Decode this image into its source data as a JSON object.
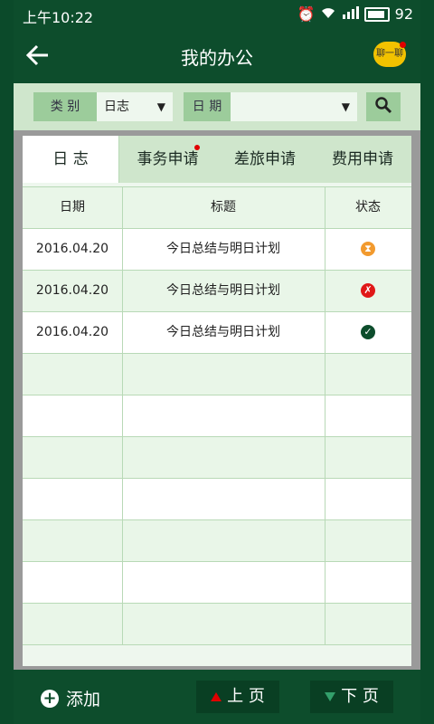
{
  "status_bar": {
    "time": "上午10:22",
    "battery": "92",
    "icons": [
      "alarm-icon",
      "wifi-icon",
      "signal-4g-icon",
      "battery-icon"
    ]
  },
  "header": {
    "back_icon": "back-arrow-icon",
    "title": "我的办公",
    "chat_label": "聊一聊"
  },
  "filters": {
    "category_label": "类 别",
    "category_value": "日志",
    "date_label": "日 期",
    "date_value": "",
    "search_icon": "search-icon"
  },
  "tabs": [
    {
      "label": "日   志",
      "active": true,
      "badge": false
    },
    {
      "label": "事务申请",
      "active": false,
      "badge": true
    },
    {
      "label": "差旅申请",
      "active": false,
      "badge": false
    },
    {
      "label": "费用申请",
      "active": false,
      "badge": false
    }
  ],
  "table": {
    "headers": [
      "日期",
      "标题",
      "状态"
    ],
    "rows": [
      {
        "date": "2016.04.20",
        "title": "今日总结与明日计划",
        "status": "pending",
        "status_icon": "hourglass-icon",
        "status_color": "#f29a2e"
      },
      {
        "date": "2016.04.20",
        "title": "今日总结与明日计划",
        "status": "rejected",
        "status_icon": "x-icon",
        "status_color": "#e01818"
      },
      {
        "date": "2016.04.20",
        "title": "今日总结与明日计划",
        "status": "approved",
        "status_icon": "check-icon",
        "status_color": "#0d4d2c"
      }
    ]
  },
  "bottom": {
    "add_label": "添加",
    "prev_label": "上 页",
    "next_label": "下 页"
  },
  "colors": {
    "primary": "#0d4d2c",
    "filter_bg": "#cfe6cc",
    "label_bg": "#9ccc9b",
    "row_alt": "#e9f6e8",
    "badge": "#e00000"
  }
}
